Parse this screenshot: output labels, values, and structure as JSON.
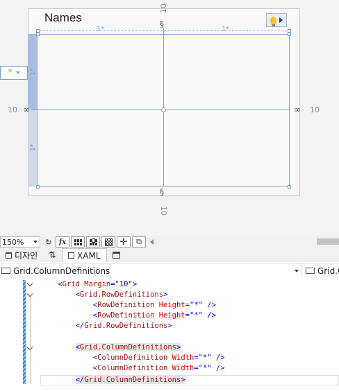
{
  "designer": {
    "window_title": "Names",
    "margins": {
      "top": "10",
      "bottom": "10",
      "left": "10",
      "right": "10"
    },
    "column_sizes": [
      "1*",
      "1*"
    ],
    "row_sizes": [
      "1*",
      "1*"
    ],
    "row_sizer_symbol": "*"
  },
  "toolbar": {
    "zoom": "150%",
    "fx_label": "fx",
    "refresh_glyph": "↻"
  },
  "tabs": [
    {
      "label": "디자인"
    },
    {
      "label": "⇅"
    },
    {
      "label": "XAML"
    }
  ],
  "nav_bar": {
    "primary": "Grid.ColumnDefinitions",
    "secondary": "Grid.C"
  },
  "code": {
    "lines": [
      {
        "indent": "    ",
        "open": "<",
        "name": "Grid",
        "attrs": [
          {
            "name": "Margin",
            "value": "\"10\""
          }
        ],
        "close": ">"
      },
      {
        "indent": "        ",
        "open": "<",
        "name": "Grid.RowDefinitions",
        "attrs": [],
        "close": ">"
      },
      {
        "indent": "            ",
        "open": "<",
        "name": "RowDefinition",
        "attrs": [
          {
            "name": "Height",
            "value": "\"*\""
          }
        ],
        "close": " />"
      },
      {
        "indent": "            ",
        "open": "<",
        "name": "RowDefinition",
        "attrs": [
          {
            "name": "Height",
            "value": "\"*\""
          }
        ],
        "close": " />"
      },
      {
        "indent": "        ",
        "open": "</",
        "name": "Grid.RowDefinitions",
        "attrs": [],
        "close": ">"
      },
      {
        "indent": "",
        "open": "",
        "name": "",
        "attrs": [],
        "close": ""
      },
      {
        "indent": "        ",
        "open": "<",
        "name": "Grid.ColumnDefinitions",
        "attrs": [],
        "close": ">"
      },
      {
        "indent": "            ",
        "open": "<",
        "name": "ColumnDefinition",
        "attrs": [
          {
            "name": "Width",
            "value": "\"*\""
          }
        ],
        "close": " />"
      },
      {
        "indent": "            ",
        "open": "<",
        "name": "ColumnDefinition",
        "attrs": [
          {
            "name": "Width",
            "value": "\"*\""
          }
        ],
        "close": " />"
      },
      {
        "indent": "        ",
        "open": "</",
        "name": "Grid.ColumnDefinitions",
        "attrs": [],
        "close": ">"
      }
    ]
  },
  "colors": {
    "grid_line": "#7da0cf",
    "xml_bracket": "#0000ff",
    "xml_element": "#a31515",
    "xml_attribute": "#e50000",
    "change_bar": "#2d7bd2"
  }
}
